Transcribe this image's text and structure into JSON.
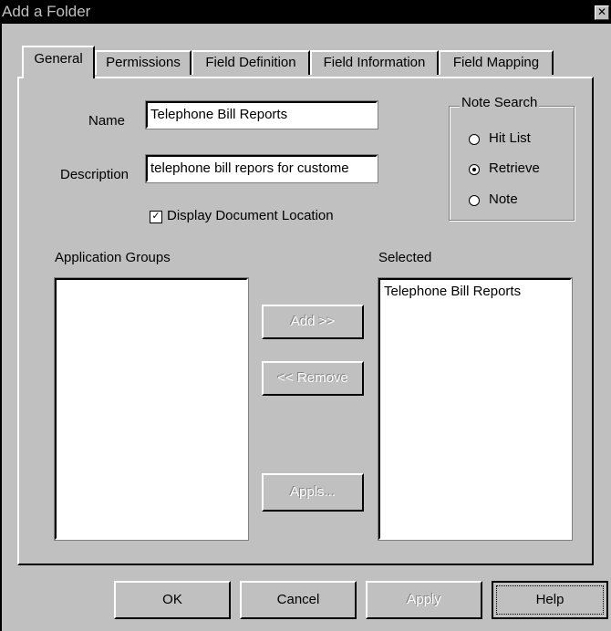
{
  "window": {
    "title": "Add a Folder",
    "close_glyph": "✕"
  },
  "tabs": [
    {
      "label": "General",
      "active": true
    },
    {
      "label": "Permissions",
      "active": false
    },
    {
      "label": "Field Definition",
      "active": false
    },
    {
      "label": "Field Information",
      "active": false
    },
    {
      "label": "Field Mapping",
      "active": false
    }
  ],
  "general": {
    "name_label": "Name",
    "name_value": "Telephone Bill Reports",
    "description_label": "Description",
    "description_value": "telephone bill repors for custome",
    "display_location_label": "Display Document Location",
    "display_location_checked": true,
    "note_search": {
      "title": "Note Search",
      "options": [
        {
          "label": "Hit List",
          "selected": false
        },
        {
          "label": "Retrieve",
          "selected": true
        },
        {
          "label": "Note",
          "selected": false
        }
      ]
    },
    "application_groups_label": "Application Groups",
    "application_groups_items": [],
    "selected_label": "Selected",
    "selected_items": [
      "Telephone Bill Reports"
    ],
    "add_button": "Add >>",
    "remove_button": "<< Remove",
    "appls_button": "Appls..."
  },
  "footer": {
    "ok": "OK",
    "cancel": "Cancel",
    "apply": "Apply",
    "help": "Help"
  }
}
